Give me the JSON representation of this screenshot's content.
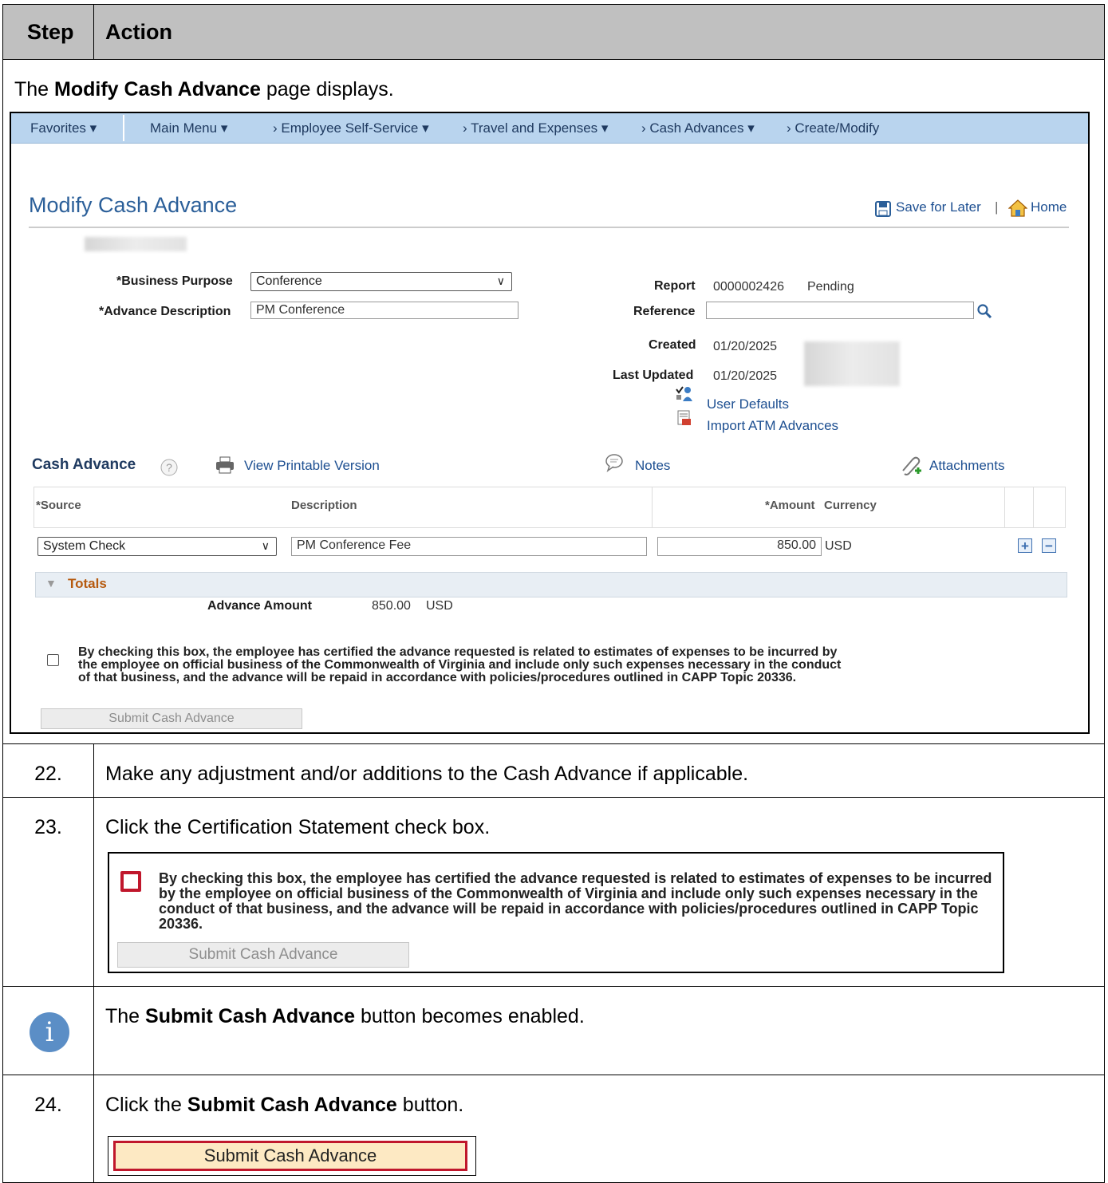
{
  "table": {
    "col_step": "Step",
    "col_action": "Action"
  },
  "intro": {
    "pre": "The ",
    "bold": "Modify Cash Advance",
    "post": " page displays."
  },
  "nav": {
    "favorites": "Favorites ▾",
    "main_menu": "Main Menu ▾",
    "crumb1": "›  Employee Self-Service ▾",
    "crumb2": "›  Travel and Expenses ▾",
    "crumb3": "›  Cash Advances ▾",
    "crumb4": "›  Create/Modify"
  },
  "page": {
    "title": "Modify Cash Advance",
    "save_for_later": "Save for Later",
    "separator": "|",
    "home": "Home",
    "business_purpose_label": "*Business Purpose",
    "business_purpose_value": "Conference",
    "advance_description_label": "*Advance Description",
    "advance_description_value": "PM Conference",
    "report_label": "Report",
    "report_number": "0000002426",
    "report_status": "Pending",
    "reference_label": "Reference",
    "reference_value": "",
    "created_label": "Created",
    "created_value": "01/20/2025",
    "last_updated_label": "Last Updated",
    "last_updated_value": "01/20/2025",
    "user_defaults": "User Defaults",
    "import_atm": "Import ATM Advances",
    "section_title": "Cash Advance",
    "view_printable": "View Printable Version",
    "notes": "Notes",
    "attachments": "Attachments",
    "columns": {
      "source": "*Source",
      "description": "Description",
      "amount": "*Amount",
      "currency": "Currency"
    },
    "row": {
      "source": "System Check",
      "description": "PM Conference Fee",
      "amount": "850.00",
      "currency": "USD"
    },
    "totals_label": "Totals",
    "advance_amount_label": "Advance Amount",
    "advance_amount_value": "850.00",
    "advance_amount_currency": "USD",
    "certification_text": "By checking this box, the employee has certified the advance requested is related to estimates of expenses to be incurred by the employee on official business of the Commonwealth of Virginia and include only such expenses necessary in the conduct of that business, and the advance will be repaid in accordance with policies/procedures outlined in CAPP Topic 20336.",
    "submit_label": "Submit Cash Advance"
  },
  "steps": [
    {
      "number": "22.",
      "text": "Make any adjustment and/or additions to the Cash Advance if applicable."
    },
    {
      "number": "23.",
      "text": "Click the Certification Statement check box."
    },
    {
      "number": "",
      "pre": "The ",
      "bold": "Submit Cash Advance",
      "post": " button becomes enabled."
    },
    {
      "number": "24.",
      "pre": "Click the ",
      "bold": "Submit Cash Advance",
      "post": " button."
    }
  ],
  "icons": [
    "caret-down-icon",
    "save-icon",
    "home-icon",
    "search-icon",
    "user-defaults-icon",
    "import-icon",
    "help-icon",
    "printer-icon",
    "notes-icon",
    "attachment-icon",
    "plus-icon",
    "minus-icon",
    "triangle-down-icon",
    "info-icon"
  ],
  "colors": {
    "header_bg": "#c0c0c0",
    "nav_bg": "#b9d4ee",
    "title_blue": "#2b5f99",
    "link_blue": "#1d4f91",
    "section_orange": "#b65a0f",
    "highlight_red": "#c0172c",
    "submit_enabled_bg": "#fde9c3"
  }
}
